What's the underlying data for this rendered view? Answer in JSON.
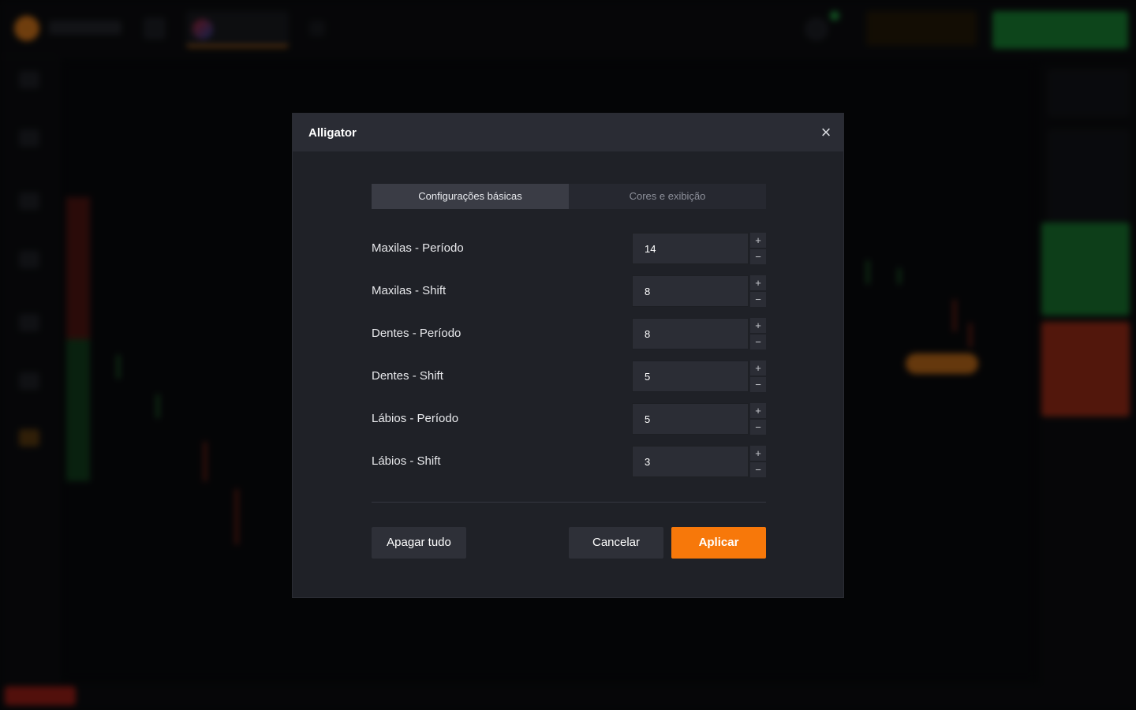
{
  "modal": {
    "title": "Alligator",
    "close_icon": "close-icon",
    "tabs": [
      {
        "label": "Configurações básicas",
        "active": true
      },
      {
        "label": "Cores e exibição",
        "active": false
      }
    ],
    "fields": [
      {
        "label": "Maxilas - Período",
        "value": "14"
      },
      {
        "label": "Maxilas - Shift",
        "value": "8"
      },
      {
        "label": "Dentes - Período",
        "value": "8"
      },
      {
        "label": "Dentes - Shift",
        "value": "5"
      },
      {
        "label": "Lábios - Período",
        "value": "5"
      },
      {
        "label": "Lábios - Shift",
        "value": "3"
      }
    ],
    "stepper": {
      "plus": "+",
      "minus": "−"
    },
    "buttons": {
      "clear": "Apagar tudo",
      "cancel": "Cancelar",
      "apply": "Aplicar"
    }
  },
  "colors": {
    "accent": "#f7780a",
    "up": "#1d8b38",
    "down": "#b7341c",
    "modal_bg": "#1f2127"
  }
}
